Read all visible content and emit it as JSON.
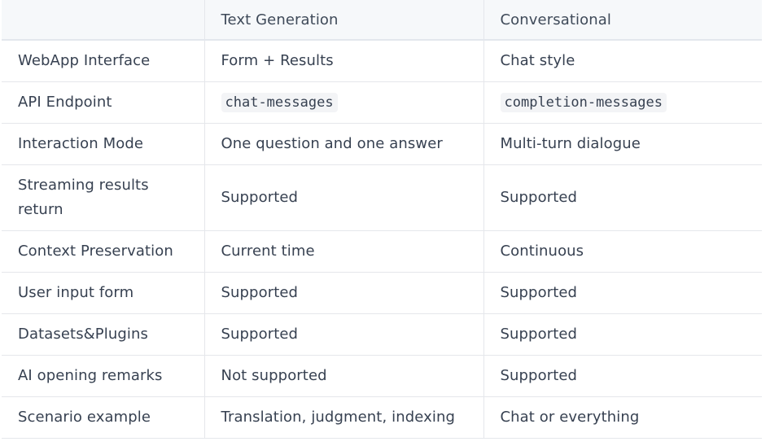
{
  "table": {
    "headers": [
      "",
      "Text Generation",
      "Conversational"
    ],
    "rows": [
      [
        "WebApp Interface",
        "Form + Results",
        "Chat style"
      ],
      [
        "API Endpoint",
        "chat-messages",
        "completion-messages"
      ],
      [
        "Interaction Mode",
        "One question and one answer",
        "Multi-turn dialogue"
      ],
      [
        "Streaming results return",
        "Supported",
        "Supported"
      ],
      [
        "Context Preservation",
        "Current time",
        "Continuous"
      ],
      [
        "User input form",
        "Supported",
        "Supported"
      ],
      [
        "Datasets&Plugins",
        "Supported",
        "Supported"
      ],
      [
        "AI opening remarks",
        "Not supported",
        "Supported"
      ],
      [
        "Scenario example",
        "Translation, judgment, indexing",
        "Chat or everything"
      ]
    ]
  }
}
